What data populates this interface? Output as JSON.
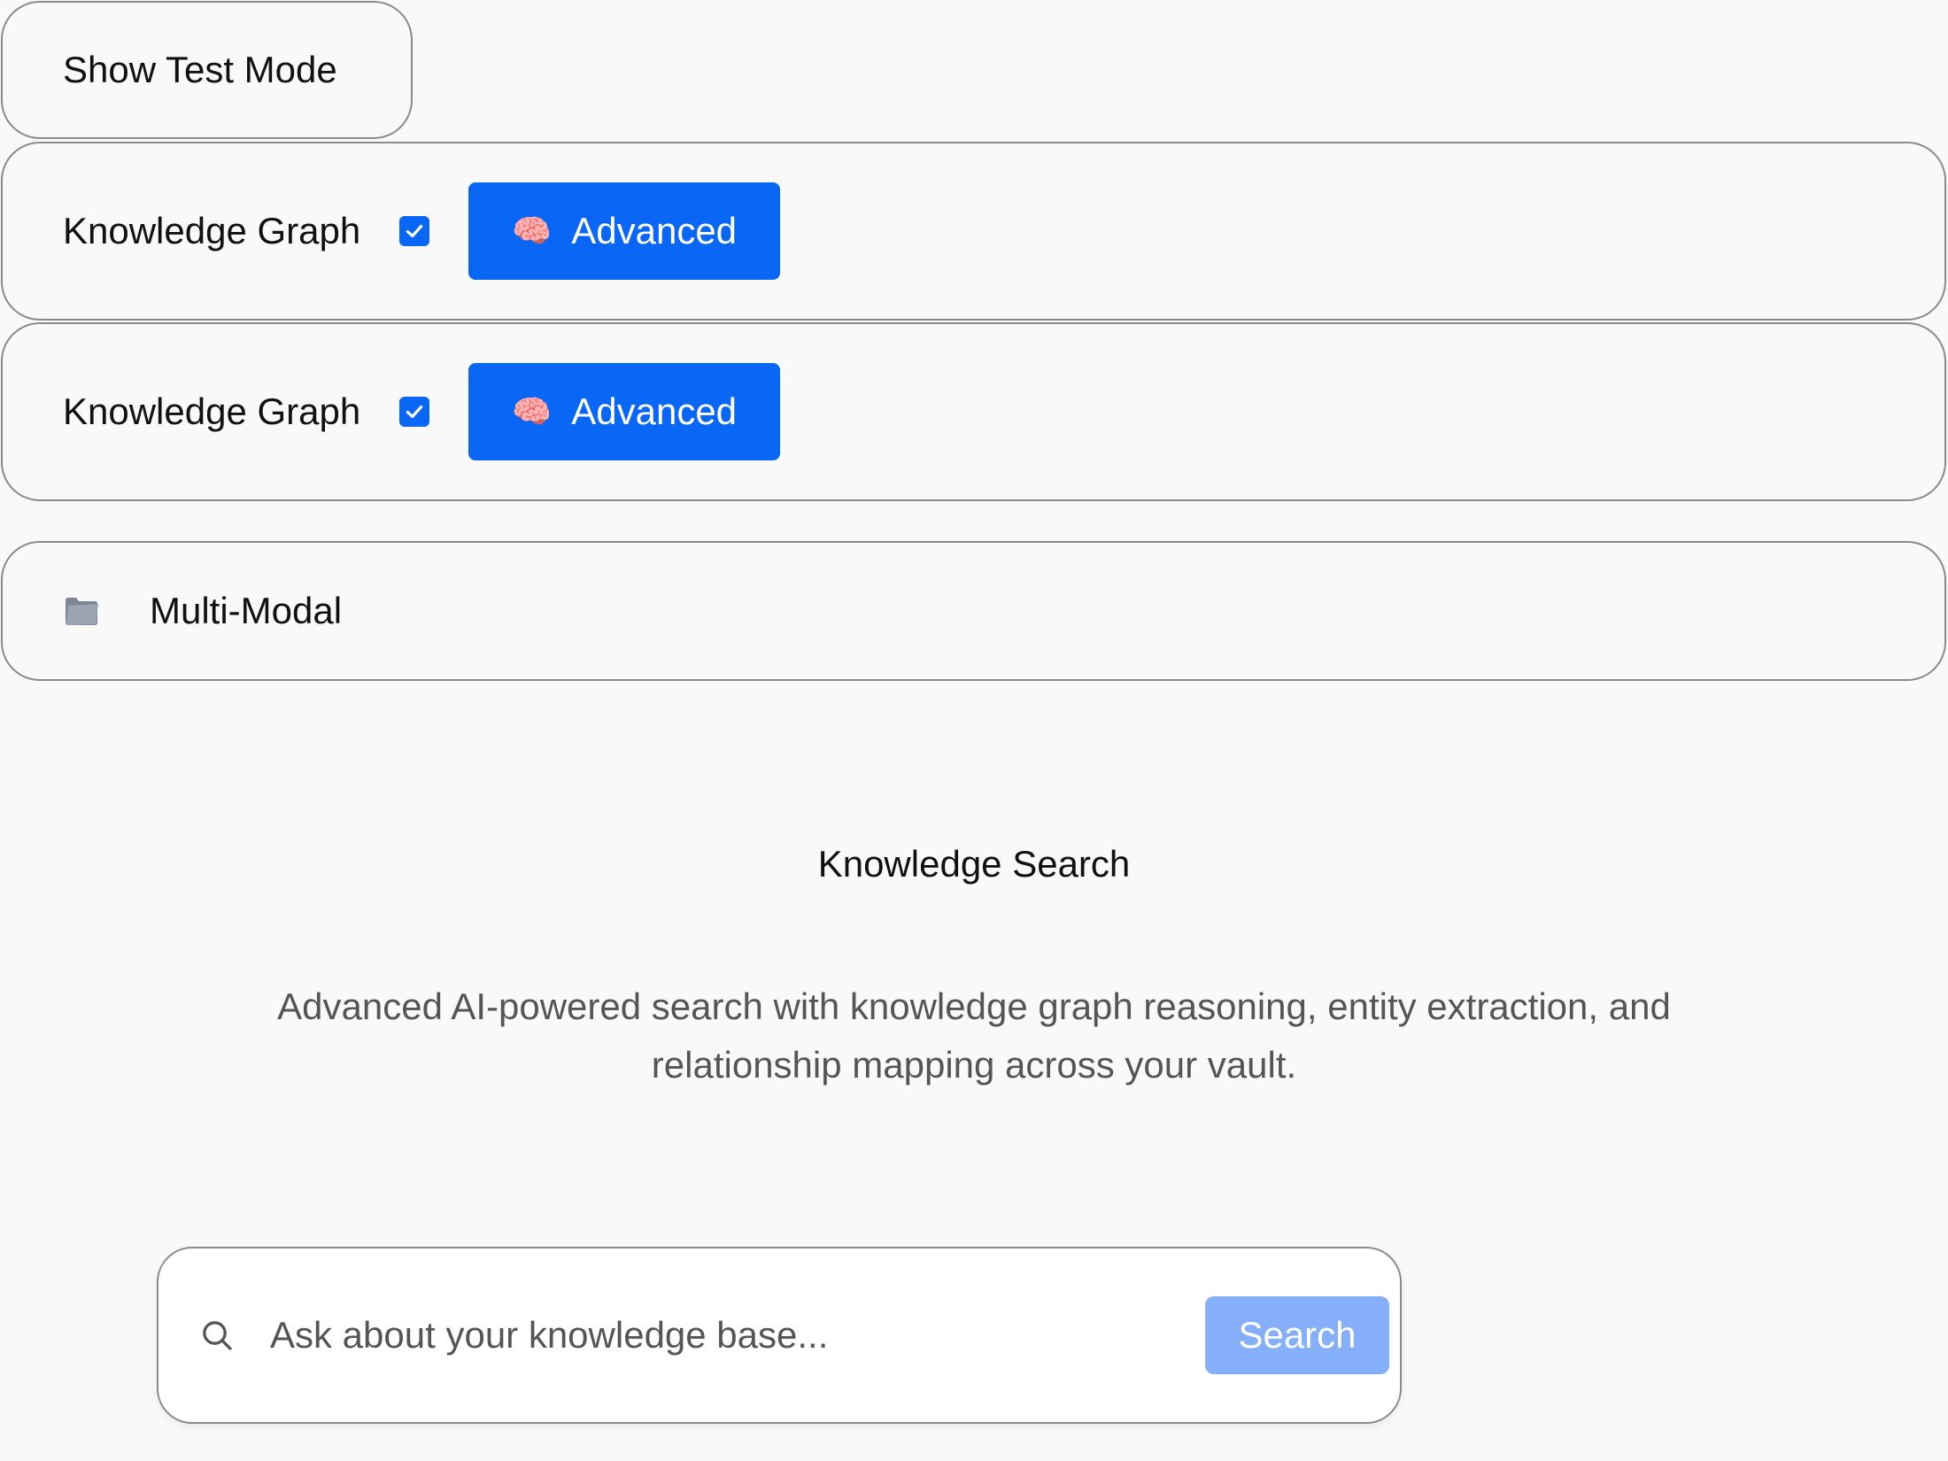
{
  "test_mode": {
    "label": "Show Test Mode"
  },
  "rows": [
    {
      "label": "Knowledge Graph",
      "checked": true,
      "button_label": "Advanced",
      "button_icon": "🧠"
    },
    {
      "label": "Knowledge Graph",
      "checked": true,
      "button_label": "Advanced",
      "button_icon": "🧠"
    }
  ],
  "multimodal": {
    "label": "Multi-Modal",
    "icon": "folder-icon"
  },
  "hero": {
    "title": "Knowledge Search",
    "description": "Advanced AI-powered search with knowledge graph reasoning, entity extraction, and relationship mapping across your vault."
  },
  "search": {
    "placeholder": "Ask about your knowledge base...",
    "value": "",
    "button_label": "Search"
  },
  "colors": {
    "accent": "#0a66f5",
    "search_button_disabled": "#85b0f9",
    "background": "#f9f9f9",
    "border": "#8a8a8a"
  }
}
